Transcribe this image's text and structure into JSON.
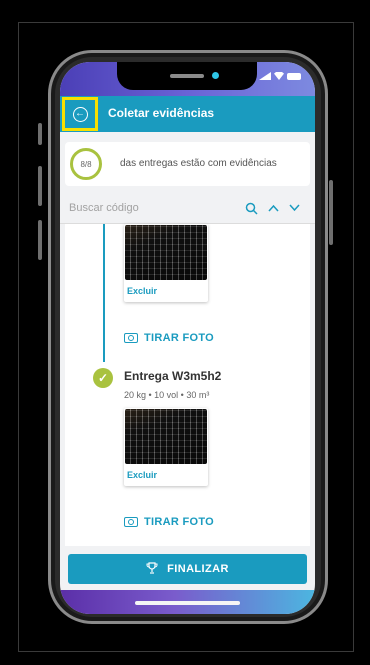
{
  "header": {
    "title": "Coletar evidências",
    "back_icon": "←"
  },
  "progress": {
    "count": "8/8",
    "text": "das entregas estão com evidências"
  },
  "search": {
    "placeholder": "Buscar código"
  },
  "items": [
    {
      "photo_action": "Excluir",
      "take_photo": "TIRAR FOTO"
    },
    {
      "title": "Entrega W3m5h2",
      "meta": "20 kg  •  10 vol  •  30 m³",
      "photo_action": "Excluir",
      "take_photo": "TIRAR FOTO"
    }
  ],
  "finalize": {
    "label": "FINALIZAR"
  },
  "colors": {
    "accent": "#1a9bbf",
    "success": "#a9c23f",
    "highlight": "#f7e000"
  }
}
